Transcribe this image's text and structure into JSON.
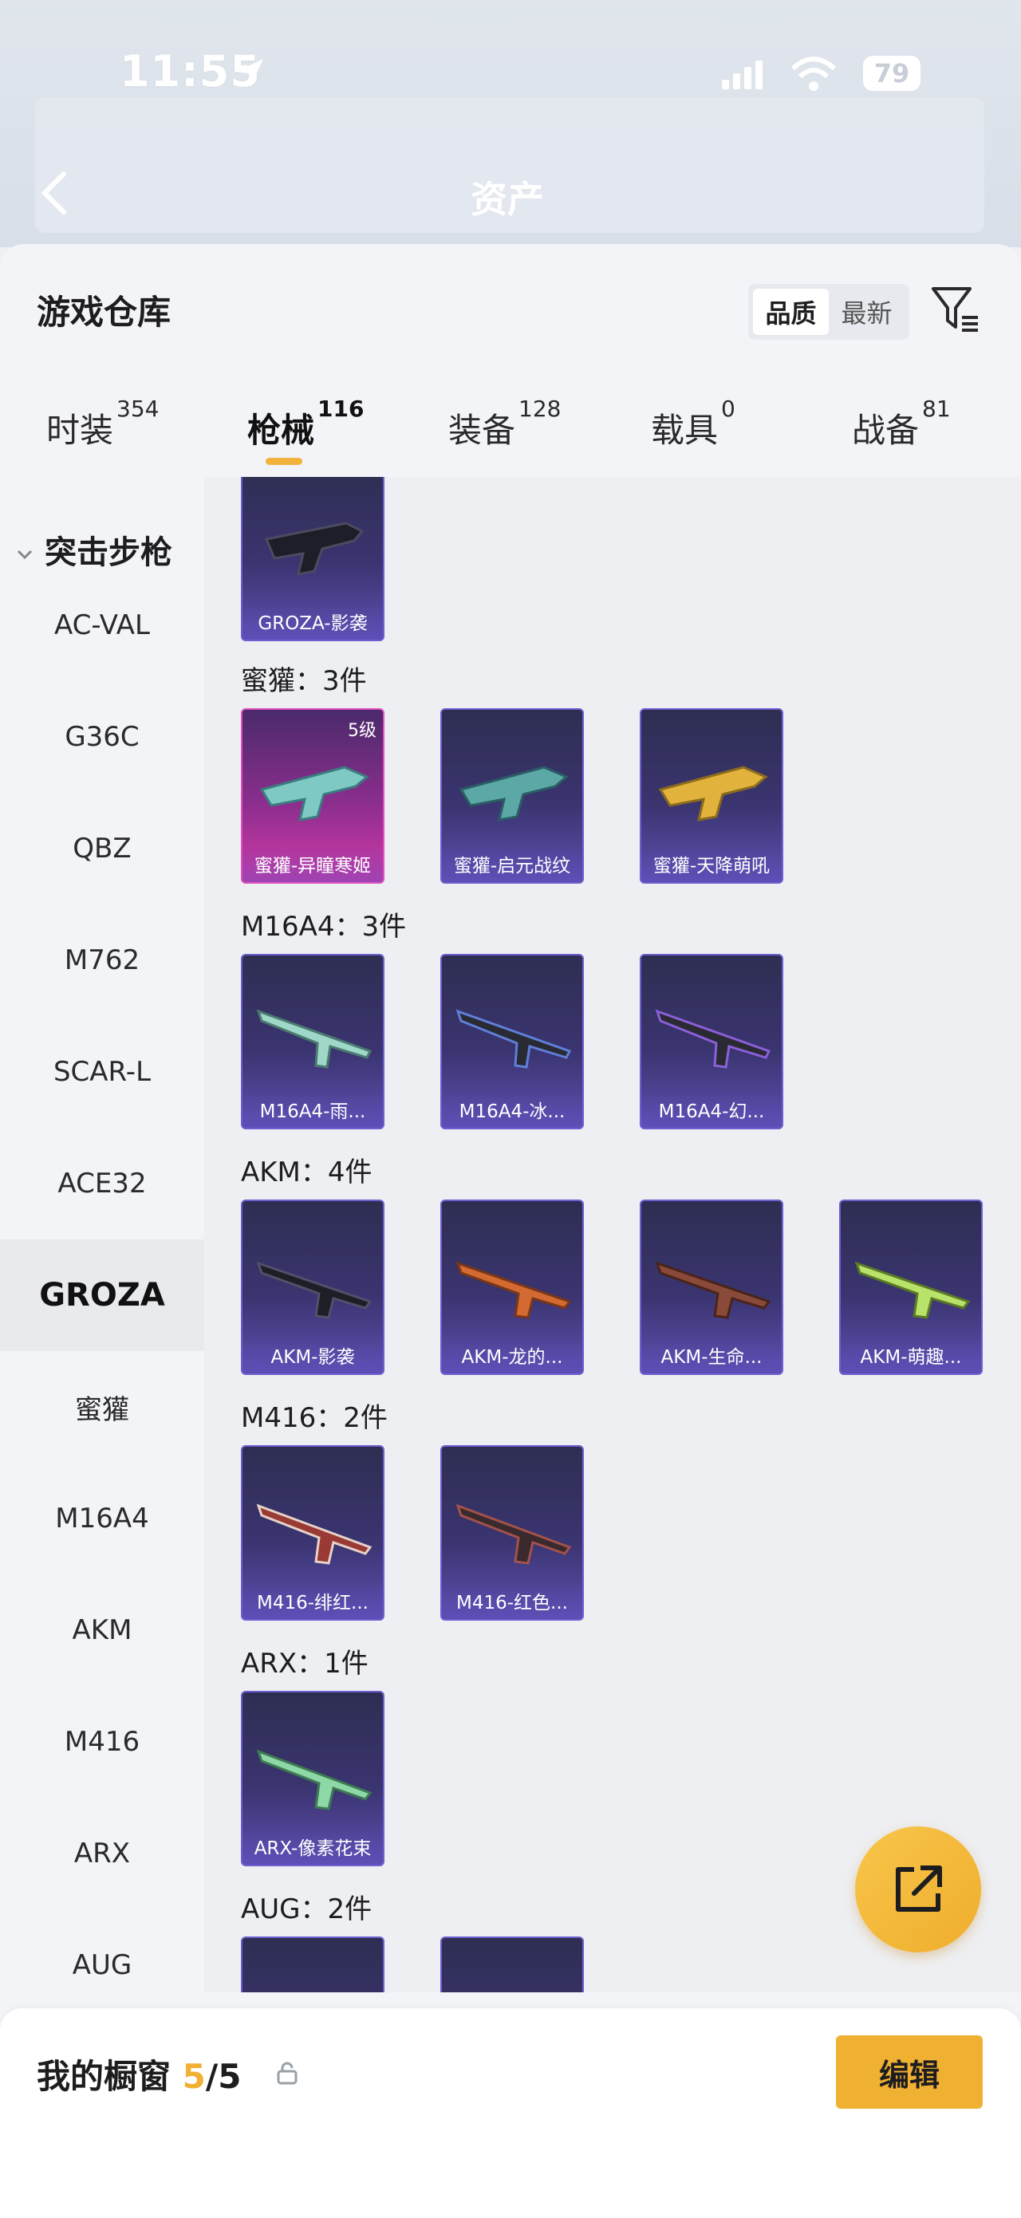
{
  "status": {
    "time": "11:55",
    "battery": "79"
  },
  "page": {
    "title": "资产"
  },
  "warehouse": {
    "title": "游戏仓库",
    "sort": {
      "quality": "品质",
      "newest": "最新"
    },
    "tabs": [
      {
        "label": "时装",
        "count": "354"
      },
      {
        "label": "枪械",
        "count": "116"
      },
      {
        "label": "装备",
        "count": "128"
      },
      {
        "label": "载具",
        "count": "0"
      },
      {
        "label": "战备",
        "count": "81"
      }
    ],
    "active_tab": "枪械",
    "sidebar": {
      "category": "突击步枪",
      "items": [
        "AC-VAL",
        "G36C",
        "QBZ",
        "M762",
        "SCAR-L",
        "ACE32",
        "GROZA",
        "蜜獾",
        "M16A4",
        "AKM",
        "M416",
        "ARX",
        "AUG"
      ],
      "active": "GROZA"
    },
    "groups": [
      {
        "label": "蜜獾：3件",
        "items": [
          {
            "name": "蜜獾-异瞳寒姬",
            "level": "5级",
            "color": "#e14fbf"
          },
          {
            "name": "蜜獾-启元战纹"
          },
          {
            "name": "蜜獾-天降萌吼"
          }
        ]
      },
      {
        "label": "M16A4：3件",
        "items": [
          {
            "name": "M16A4-雨..."
          },
          {
            "name": "M16A4-冰..."
          },
          {
            "name": "M16A4-幻..."
          }
        ]
      },
      {
        "label": "AKM：4件",
        "items": [
          {
            "name": "AKM-影袭"
          },
          {
            "name": "AKM-龙的..."
          },
          {
            "name": "AKM-生命..."
          },
          {
            "name": "AKM-萌趣..."
          }
        ]
      },
      {
        "label": "M416：2件",
        "items": [
          {
            "name": "M416-绯红..."
          },
          {
            "name": "M416-红色..."
          }
        ]
      },
      {
        "label": "ARX：1件",
        "items": [
          {
            "name": "ARX-像素花束"
          }
        ]
      },
      {
        "label": "AUG：2件",
        "items": [
          {
            "name": ""
          },
          {
            "name": ""
          }
        ]
      }
    ],
    "top_card": {
      "name": "GROZA-影袭"
    }
  },
  "showcase": {
    "label": "我的橱窗",
    "count": "5",
    "total": "/5",
    "edit": "编辑"
  },
  "colors": {
    "accent": "#f0b032",
    "card_bg": "#3a3470",
    "legendary": "#e14fbf"
  }
}
